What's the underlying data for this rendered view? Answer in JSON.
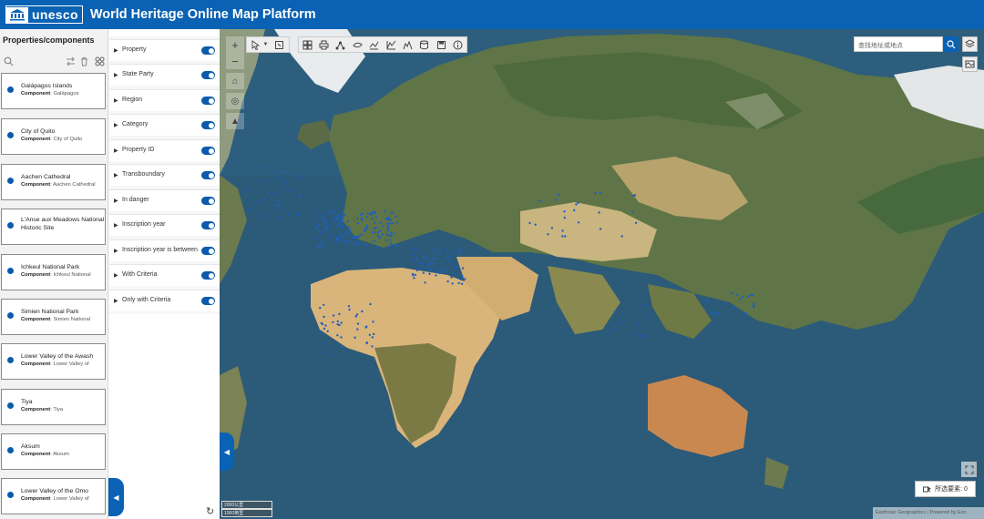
{
  "header": {
    "logo_text": "unesco",
    "title": "World Heritage Online Map Platform"
  },
  "left_panel": {
    "title": "Properties/components",
    "icons": [
      "search-icon",
      "swap-icon",
      "trash-icon",
      "grid-icon"
    ],
    "items": [
      {
        "name": "Galápagos Islands",
        "component_label": "Component",
        "component": "Galápagos"
      },
      {
        "name": "City of Quito",
        "component_label": "Component",
        "component": "City of Quito"
      },
      {
        "name": "Aachen Cathedral",
        "component_label": "Component",
        "component": "Aachen Cathedral"
      },
      {
        "name": "L'Anse aux Meadows National Historic Site",
        "component_label": "",
        "component": ""
      },
      {
        "name": "Ichkeul National Park",
        "component_label": "Component",
        "component": "Ichkeul National"
      },
      {
        "name": "Simien National Park",
        "component_label": "Component",
        "component": "Simien National"
      },
      {
        "name": "Lower Valley of the Awash",
        "component_label": "Component",
        "component": "Lower Valley of"
      },
      {
        "name": "Tiya",
        "component_label": "Component",
        "component": "Tiya"
      },
      {
        "name": "Aksum",
        "component_label": "Component",
        "component": "Aksum"
      },
      {
        "name": "Lower Valley of the Omo",
        "component_label": "Component",
        "component": "Lower Valley of"
      }
    ]
  },
  "filters": [
    {
      "label": "Property",
      "enabled": true
    },
    {
      "label": "State Party",
      "enabled": true
    },
    {
      "label": "Region",
      "enabled": true
    },
    {
      "label": "Category",
      "enabled": true
    },
    {
      "label": "Property ID",
      "enabled": true
    },
    {
      "label": "Transboundary",
      "enabled": true
    },
    {
      "label": "In danger",
      "enabled": true
    },
    {
      "label": "Inscription year",
      "enabled": true
    },
    {
      "label": "Inscription year is between",
      "enabled": true
    },
    {
      "label": "With Criteria",
      "enabled": true
    },
    {
      "label": "Only with Criteria",
      "enabled": true
    }
  ],
  "map": {
    "search_placeholder": "查找地址或地点",
    "selected_features_label": "所选要素: 0",
    "scale_top": "2000公里",
    "scale_bottom": "1000英里",
    "attribution": "Earthstar Geographics | Powered by Esri",
    "colors": {
      "accent": "#0a62b4",
      "site_dot": "#1f5fbf",
      "ocean": "#2c5a79"
    }
  }
}
